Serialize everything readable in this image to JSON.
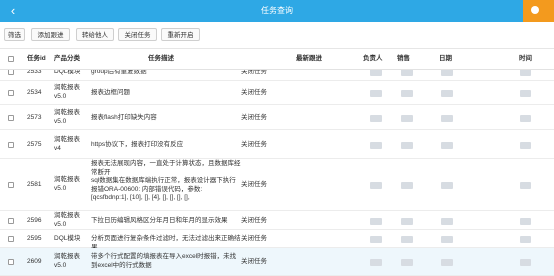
{
  "header": {
    "title": "任务查询"
  },
  "toolbar": {
    "buttons": [
      "筛选",
      "添加跟进",
      "转给他人",
      "关闭任务",
      "重新开启"
    ]
  },
  "table": {
    "columns": [
      "任务id",
      "产品分类",
      "任务描述",
      "最新跟进",
      "负责人",
      "销售",
      "日期",
      "时间"
    ],
    "rows": [
      {
        "id": "2533",
        "product": "DQL模块",
        "desc": "group后有重复数据",
        "followup": "关闭任务"
      },
      {
        "id": "2534",
        "product": "润乾报表\nv5.0",
        "desc": "报表边框问题",
        "followup": "关闭任务"
      },
      {
        "id": "2573",
        "product": "润乾报表\nv5.0",
        "desc": "报表flash打印缺失内容",
        "followup": "关闭任务"
      },
      {
        "id": "2575",
        "product": "润乾报表\nv4",
        "desc": "https协议下，报表打印没有反应",
        "followup": "关闭任务"
      },
      {
        "id": "2581",
        "product": "润乾报表\nv5.0",
        "desc": "报表无法展现内容，一直处于计算状态，且数据库经常断开\nsql数据集在数据库端执行正常，报表设计器下执行报错ORA-00600: 内部错误代码，参数: [qcsfbdnp:1], [10], [], [4], [], [], [], [],",
        "followup": "关闭任务"
      },
      {
        "id": "2596",
        "product": "润乾报表\nv5.0",
        "desc": "下拉日历编辑风格区分年月日和年月的显示效果",
        "followup": "关闭任务"
      },
      {
        "id": "2595",
        "product": "DQL模块",
        "desc": "分析页面进行复杂条件过滤时，无法过滤出来正确结果",
        "followup": "关闭任务"
      },
      {
        "id": "2609",
        "product": "润乾报表\nv5.0",
        "desc": "带多个行式配置的填报表在导入excel时报错，未找到excel中的行式数据",
        "followup": "关闭任务"
      }
    ]
  }
}
